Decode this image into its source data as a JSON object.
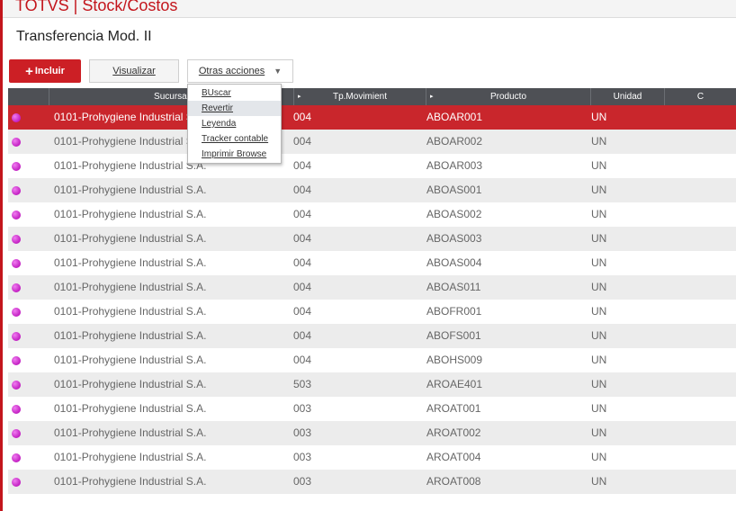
{
  "header": {
    "title": "TOTVS | Stock/Costos"
  },
  "page": {
    "title": "Transferencia Mod. II"
  },
  "toolbar": {
    "incluir_plus": "+",
    "incluir_label": "Incluir",
    "visualizar_label": "Visualizar",
    "otras_label": "Otras acciones",
    "otras_caret": "▼"
  },
  "menu": {
    "items": [
      "BUscar",
      "Revertir",
      "Leyenda",
      "Tracker contable",
      "Imprimir Browse"
    ],
    "active_index": 1
  },
  "table": {
    "arrow": "▸",
    "columns": [
      "Sucursal",
      "Tp.Movimient",
      "Producto",
      "Unidad",
      "C"
    ],
    "rows": [
      {
        "sucursal": "0101-Prohygiene Industrial S.A.",
        "tp": "004",
        "producto": "ABOAR001",
        "unidad": "UN"
      },
      {
        "sucursal": "0101-Prohygiene Industrial S.A.",
        "tp": "004",
        "producto": "ABOAR002",
        "unidad": "UN"
      },
      {
        "sucursal": "0101-Prohygiene Industrial S.A.",
        "tp": "004",
        "producto": "ABOAR003",
        "unidad": "UN"
      },
      {
        "sucursal": "0101-Prohygiene Industrial S.A.",
        "tp": "004",
        "producto": "ABOAS001",
        "unidad": "UN"
      },
      {
        "sucursal": "0101-Prohygiene Industrial S.A.",
        "tp": "004",
        "producto": "ABOAS002",
        "unidad": "UN"
      },
      {
        "sucursal": "0101-Prohygiene Industrial S.A.",
        "tp": "004",
        "producto": "ABOAS003",
        "unidad": "UN"
      },
      {
        "sucursal": "0101-Prohygiene Industrial S.A.",
        "tp": "004",
        "producto": "ABOAS004",
        "unidad": "UN"
      },
      {
        "sucursal": "0101-Prohygiene Industrial S.A.",
        "tp": "004",
        "producto": "ABOAS011",
        "unidad": "UN"
      },
      {
        "sucursal": "0101-Prohygiene Industrial S.A.",
        "tp": "004",
        "producto": "ABOFR001",
        "unidad": "UN"
      },
      {
        "sucursal": "0101-Prohygiene Industrial S.A.",
        "tp": "004",
        "producto": "ABOFS001",
        "unidad": "UN"
      },
      {
        "sucursal": "0101-Prohygiene Industrial S.A.",
        "tp": "004",
        "producto": "ABOHS009",
        "unidad": "UN"
      },
      {
        "sucursal": "0101-Prohygiene Industrial S.A.",
        "tp": "503",
        "producto": "AROAE401",
        "unidad": "UN"
      },
      {
        "sucursal": "0101-Prohygiene Industrial S.A.",
        "tp": "003",
        "producto": "AROAT001",
        "unidad": "UN"
      },
      {
        "sucursal": "0101-Prohygiene Industrial S.A.",
        "tp": "003",
        "producto": "AROAT002",
        "unidad": "UN"
      },
      {
        "sucursal": "0101-Prohygiene Industrial S.A.",
        "tp": "003",
        "producto": "AROAT004",
        "unidad": "UN"
      },
      {
        "sucursal": "0101-Prohygiene Industrial S.A.",
        "tp": "003",
        "producto": "AROAT008",
        "unidad": "UN"
      }
    ],
    "selected_index": 0
  },
  "colors": {
    "brand_red": "#c3151c",
    "selected_row": "#c9262c",
    "header_bg": "#4e5055",
    "status_dot": "#d634d6"
  },
  "icons": {
    "status": "status-dot-icon",
    "sort": "sort-arrow-icon",
    "dropdown": "chevron-down-icon"
  }
}
